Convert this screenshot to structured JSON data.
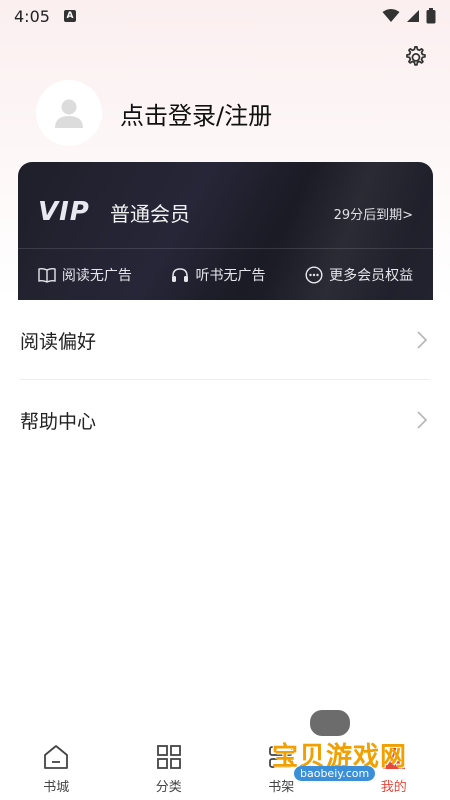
{
  "status_bar": {
    "time": "4:05",
    "notif_letter": "A"
  },
  "profile": {
    "login_label": "点击登录/注册"
  },
  "vip": {
    "badge": "VIP",
    "level": "普通会员",
    "expire": "29分后到期>",
    "benefits": [
      {
        "icon": "book-icon",
        "label": "阅读无广告"
      },
      {
        "icon": "headphones-icon",
        "label": "听书无广告"
      },
      {
        "icon": "more-icon",
        "label": "更多会员权益"
      }
    ]
  },
  "menu": [
    {
      "label": "阅读偏好"
    },
    {
      "label": "帮助中心"
    }
  ],
  "bottom_nav": [
    {
      "icon": "home-icon",
      "label": "书城"
    },
    {
      "icon": "category-icon",
      "label": "分类"
    },
    {
      "icon": "bookshelf-icon",
      "label": "书架"
    },
    {
      "icon": "profile-icon",
      "label": "我的",
      "active": true
    }
  ],
  "watermark": {
    "title": "宝贝游戏网",
    "url": "baobeiy.com"
  },
  "colors": {
    "accent": "#e34a3c",
    "card_bg": "#1f1f2a",
    "watermark": "#f0a000"
  }
}
